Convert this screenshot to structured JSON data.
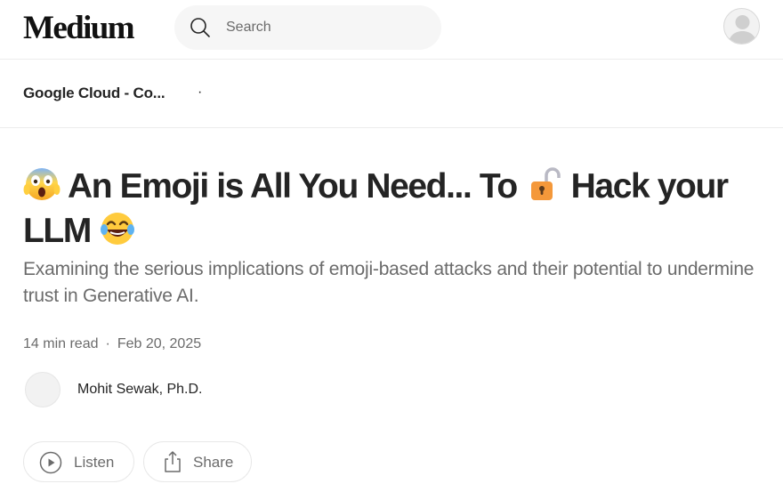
{
  "header": {
    "logo_text": "Medium",
    "search": {
      "placeholder": "Search",
      "value": ""
    }
  },
  "publication": {
    "name": "Google Cloud - Co...",
    "separator": "·"
  },
  "article": {
    "title_part1": "An Emoji is All You Need... To",
    "title_part2": "Hack your LLM",
    "subtitle": "Examining the serious implications of emoji-based attacks and their potential to undermine trust in Generative AI.",
    "read_time": "14 min read",
    "meta_separator": "·",
    "date": "Feb 20, 2025",
    "author_name": "Mohit Sewak, Ph.D."
  },
  "actions": {
    "listen_label": "Listen",
    "share_label": "Share"
  },
  "icons": {
    "search": "search-icon",
    "profile": "user-avatar-icon",
    "listen": "play-circle-icon",
    "share": "share-icon",
    "emoji_scream": "face-screaming-in-fear-emoji",
    "emoji_lock": "unlocked-padlock-emoji",
    "emoji_laugh": "face-with-tears-of-joy-emoji"
  },
  "colors": {
    "text": "#242424",
    "muted": "#6b6b6b",
    "search_bg": "#f6f6f6",
    "divider": "#ececec"
  }
}
